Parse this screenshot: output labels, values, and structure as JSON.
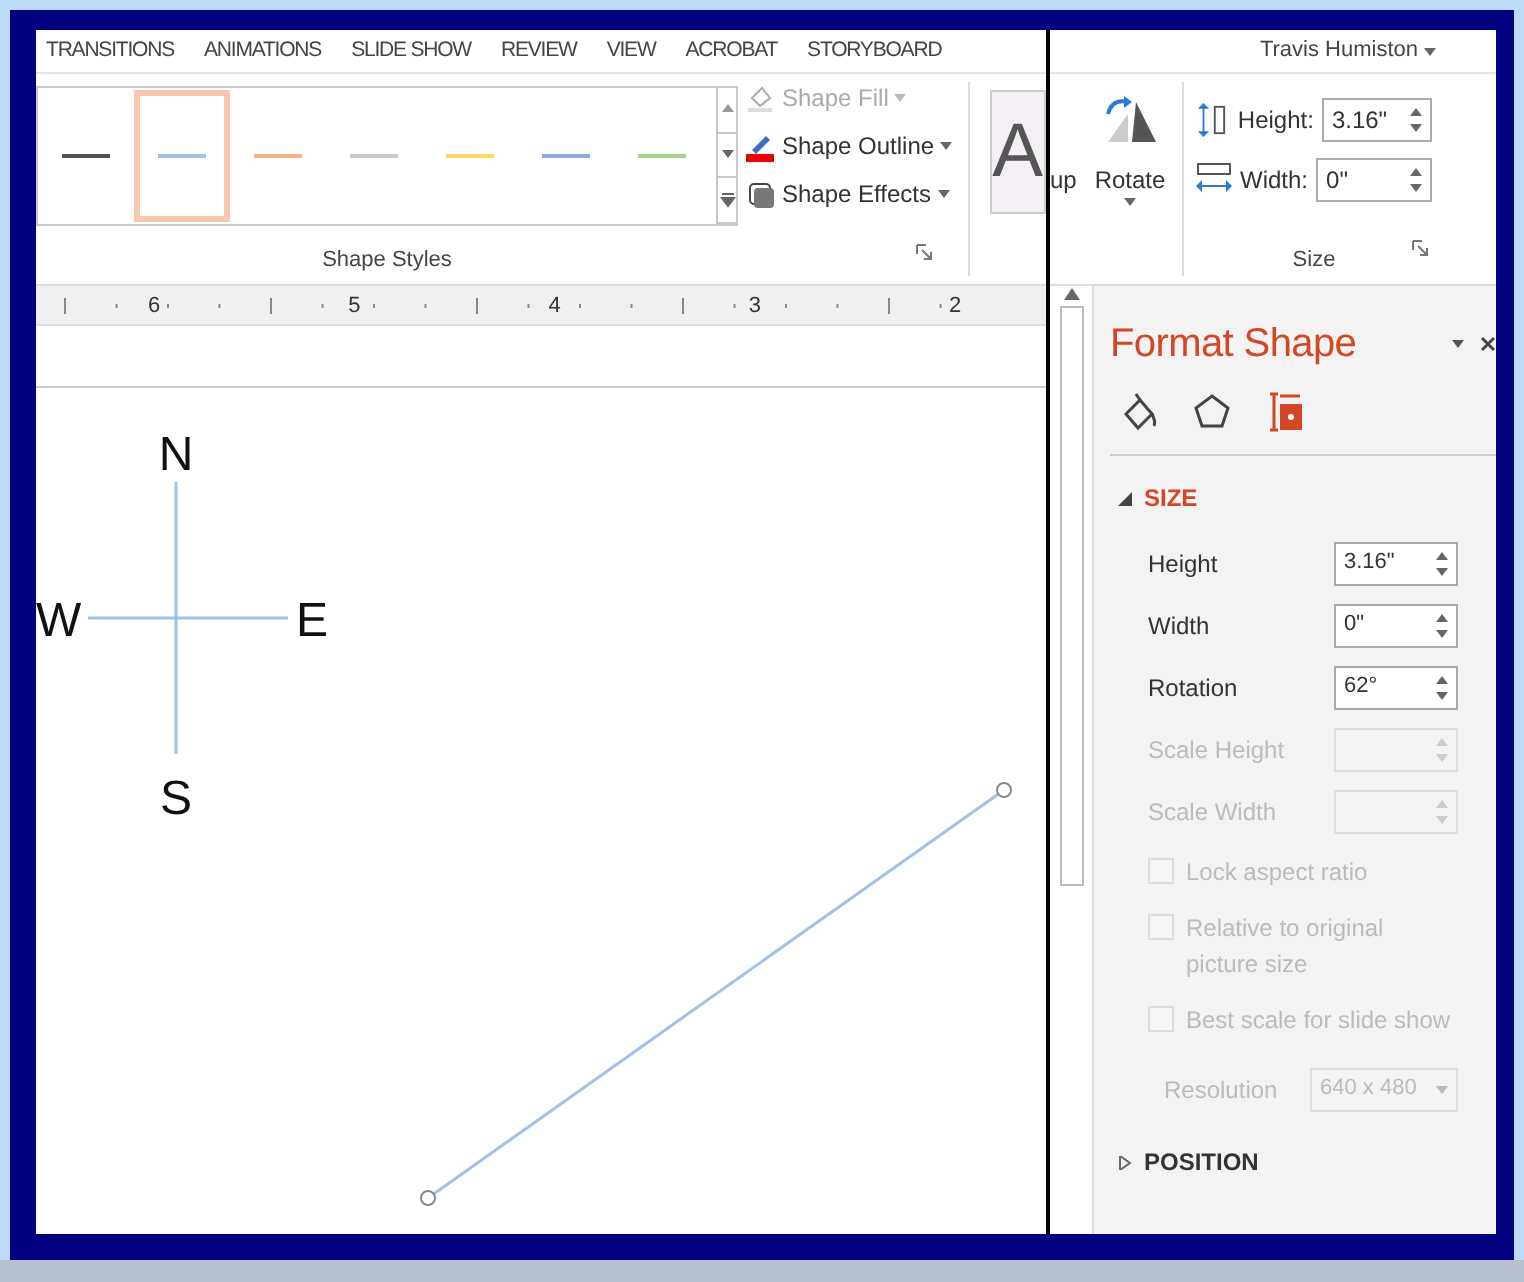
{
  "ribbon_tabs": [
    "TRANSITIONS",
    "ANIMATIONS",
    "SLIDE SHOW",
    "REVIEW",
    "VIEW",
    "ACROBAT",
    "STORYBOARD"
  ],
  "user": {
    "name": "Travis Humiston"
  },
  "style_gallery": [
    {
      "color": "#505050",
      "selected": false
    },
    {
      "color": "#9dc3e6",
      "selected": true
    },
    {
      "color": "#f4b183",
      "selected": false
    },
    {
      "color": "#c9c9c9",
      "selected": false
    },
    {
      "color": "#ffd966",
      "selected": false
    },
    {
      "color": "#8faadc",
      "selected": false
    },
    {
      "color": "#a9d18e",
      "selected": false
    }
  ],
  "shape_commands": [
    {
      "kind": "fill",
      "label": "Shape Fill",
      "disabled": true
    },
    {
      "kind": "outline",
      "label": "Shape Outline",
      "disabled": false
    },
    {
      "kind": "effects",
      "label": "Shape Effects",
      "disabled": false
    }
  ],
  "wordart_sample": "A",
  "shape_styles_group": "Shape Styles",
  "arrange": {
    "cut_label": "up",
    "rotate": "Rotate"
  },
  "size_group": {
    "label": "Size",
    "fields": [
      {
        "kind": "height",
        "label": "Height:",
        "value": "3.16\""
      },
      {
        "kind": "width",
        "label": "Width:",
        "value": "0\""
      }
    ]
  },
  "ruler": [
    "6",
    "5",
    "4",
    "3",
    "2"
  ],
  "compass": {
    "north": "N",
    "west": "W",
    "east": "E",
    "south": "S"
  },
  "format_pane": {
    "title": "Format Shape",
    "tabs": [
      {
        "kind": "fill",
        "selected": false
      },
      {
        "kind": "effects",
        "selected": false
      },
      {
        "kind": "size",
        "selected": true
      }
    ],
    "sections": [
      {
        "title": "SIZE",
        "expanded": true,
        "fields": [
          {
            "label": "Height",
            "value": "3.16\"",
            "disabled": false
          },
          {
            "label": "Width",
            "value": "0\"",
            "disabled": false
          },
          {
            "label": "Rotation",
            "value": "62°",
            "disabled": false
          },
          {
            "label": "Scale Height",
            "disabled": true
          },
          {
            "label": "Scale Width",
            "disabled": true
          }
        ],
        "checkboxes": [
          {
            "label": "Lock aspect ratio",
            "checked": false,
            "disabled": true
          },
          {
            "label": "Relative to original picture size",
            "checked": false,
            "disabled": true
          },
          {
            "label": "Best scale for slide show",
            "checked": false,
            "disabled": true
          }
        ],
        "resolution": {
          "label": "Resolution",
          "value": "640 x 480",
          "disabled": true
        }
      },
      {
        "title": "POSITION",
        "expanded": false
      }
    ]
  }
}
